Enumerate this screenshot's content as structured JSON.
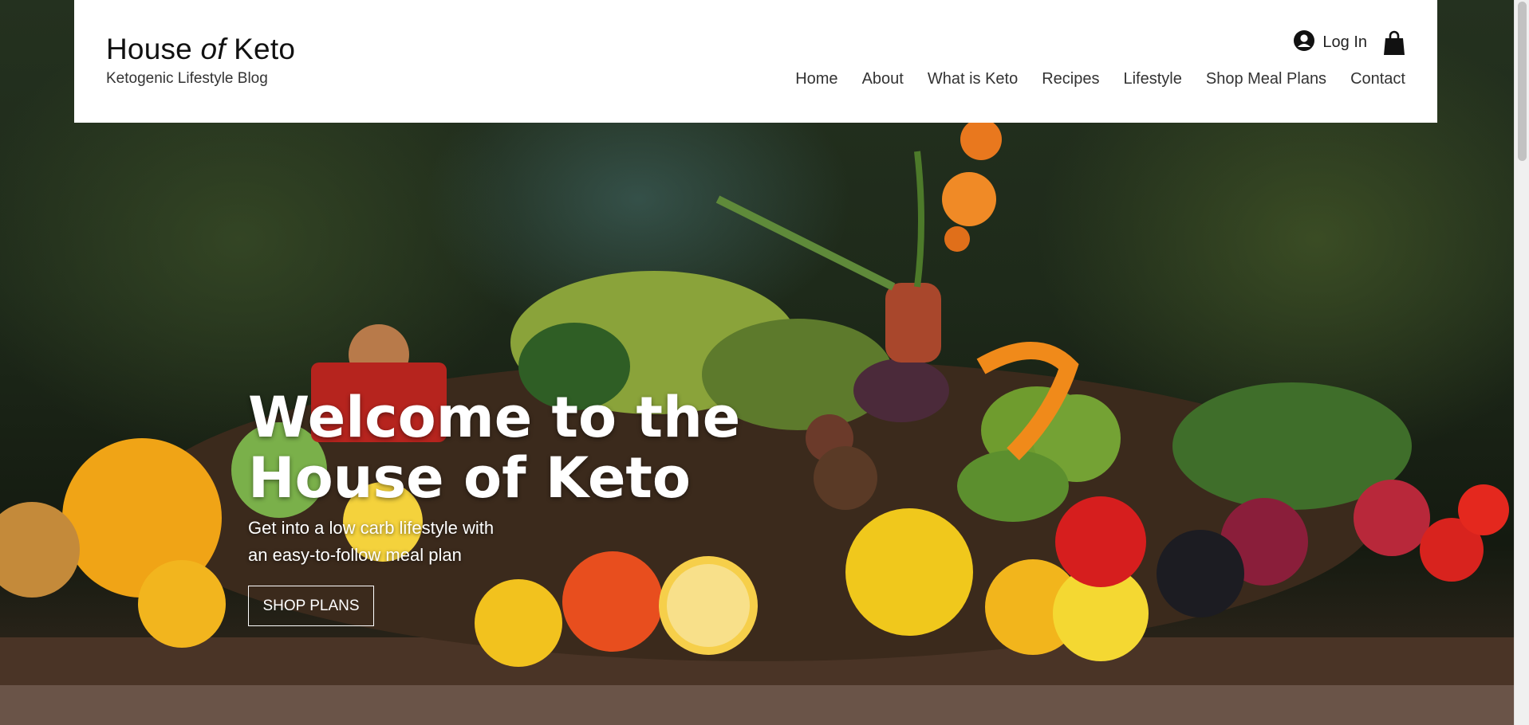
{
  "site": {
    "title_prefix": "House ",
    "title_italic": "of",
    "title_suffix": " Keto",
    "tagline": "Ketogenic Lifestyle Blog"
  },
  "account": {
    "login_label": "Log In",
    "icon": "user-circle-icon"
  },
  "cart": {
    "icon": "shopping-bag-icon"
  },
  "nav": {
    "items": [
      "Home",
      "About",
      "What is Keto",
      "Recipes",
      "Lifestyle",
      "Shop Meal Plans",
      "Contact"
    ]
  },
  "hero": {
    "title_line1": "Welcome to the",
    "title_line2": "House of Keto",
    "subtitle_line1": "Get into a low carb lifestyle with",
    "subtitle_line2": "an easy-to-follow meal plan",
    "cta_label": "SHOP PLANS"
  },
  "colors": {
    "header_bg": "#ffffff",
    "text_dark": "#111111",
    "hero_text": "#ffffff"
  }
}
